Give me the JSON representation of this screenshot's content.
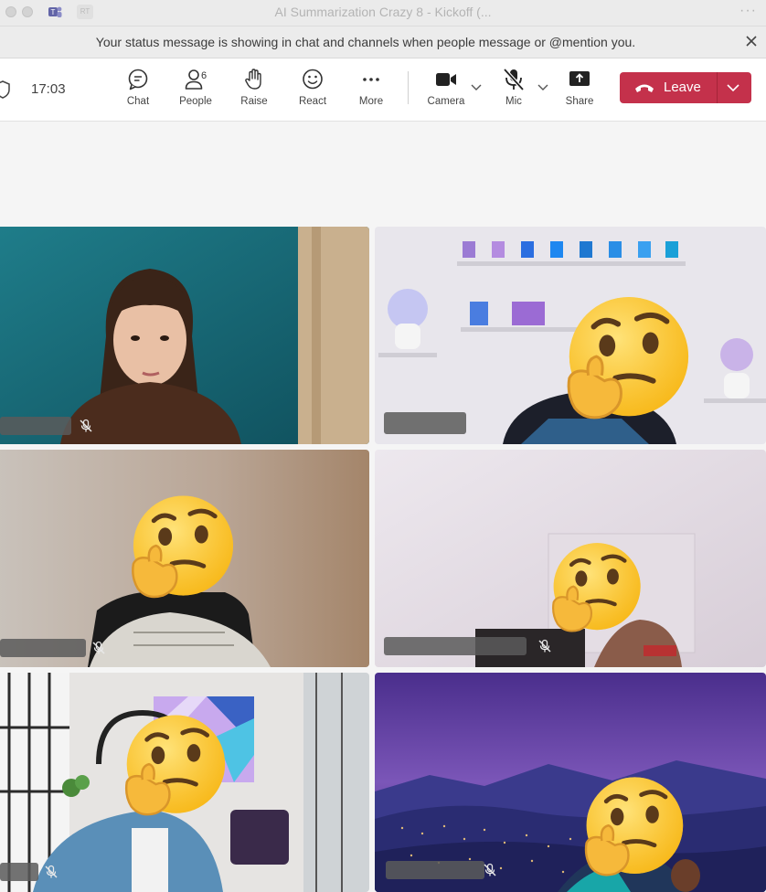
{
  "window": {
    "title": "AI Summarization Crazy 8 - Kickoff (...",
    "avatar_initials": "RT",
    "more_symbol": "···"
  },
  "banner": {
    "message": "Your status message is showing in chat and channels when people message or @mention you.",
    "close_icon": "close-icon"
  },
  "toolbar": {
    "timer": "17:03",
    "chat_label": "Chat",
    "people_label": "People",
    "people_count": "6",
    "raise_label": "Raise",
    "react_label": "React",
    "more_label": "More",
    "camera_label": "Camera",
    "mic_label": "Mic",
    "share_label": "Share",
    "leave_label": "Leave"
  },
  "colors": {
    "leave": "#c4314b",
    "toolbar_bg": "#ffffff",
    "stage_bg": "#f5f5f5"
  },
  "participants": [
    {
      "tile": "top-left",
      "mic": "muted",
      "face": "visible"
    },
    {
      "tile": "top-right",
      "mic": "muted",
      "face": "thinking-face-emoji"
    },
    {
      "tile": "middle-left",
      "mic": "muted",
      "face": "thinking-face-emoji"
    },
    {
      "tile": "middle-right",
      "mic": "muted",
      "face": "thinking-face-emoji"
    },
    {
      "tile": "bottom-left",
      "mic": "muted",
      "face": "thinking-face-emoji"
    },
    {
      "tile": "bottom-right",
      "mic": "muted",
      "face": "thinking-face-emoji"
    }
  ]
}
